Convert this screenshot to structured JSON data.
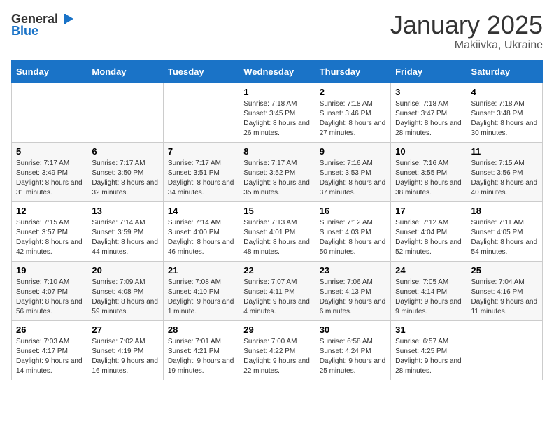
{
  "header": {
    "logo_general": "General",
    "logo_blue": "Blue",
    "month_year": "January 2025",
    "location": "Makiivka, Ukraine"
  },
  "weekdays": [
    "Sunday",
    "Monday",
    "Tuesday",
    "Wednesday",
    "Thursday",
    "Friday",
    "Saturday"
  ],
  "weeks": [
    [
      {
        "day": "",
        "sunrise": "",
        "sunset": "",
        "daylight": ""
      },
      {
        "day": "",
        "sunrise": "",
        "sunset": "",
        "daylight": ""
      },
      {
        "day": "",
        "sunrise": "",
        "sunset": "",
        "daylight": ""
      },
      {
        "day": "1",
        "sunrise": "Sunrise: 7:18 AM",
        "sunset": "Sunset: 3:45 PM",
        "daylight": "Daylight: 8 hours and 26 minutes."
      },
      {
        "day": "2",
        "sunrise": "Sunrise: 7:18 AM",
        "sunset": "Sunset: 3:46 PM",
        "daylight": "Daylight: 8 hours and 27 minutes."
      },
      {
        "day": "3",
        "sunrise": "Sunrise: 7:18 AM",
        "sunset": "Sunset: 3:47 PM",
        "daylight": "Daylight: 8 hours and 28 minutes."
      },
      {
        "day": "4",
        "sunrise": "Sunrise: 7:18 AM",
        "sunset": "Sunset: 3:48 PM",
        "daylight": "Daylight: 8 hours and 30 minutes."
      }
    ],
    [
      {
        "day": "5",
        "sunrise": "Sunrise: 7:17 AM",
        "sunset": "Sunset: 3:49 PM",
        "daylight": "Daylight: 8 hours and 31 minutes."
      },
      {
        "day": "6",
        "sunrise": "Sunrise: 7:17 AM",
        "sunset": "Sunset: 3:50 PM",
        "daylight": "Daylight: 8 hours and 32 minutes."
      },
      {
        "day": "7",
        "sunrise": "Sunrise: 7:17 AM",
        "sunset": "Sunset: 3:51 PM",
        "daylight": "Daylight: 8 hours and 34 minutes."
      },
      {
        "day": "8",
        "sunrise": "Sunrise: 7:17 AM",
        "sunset": "Sunset: 3:52 PM",
        "daylight": "Daylight: 8 hours and 35 minutes."
      },
      {
        "day": "9",
        "sunrise": "Sunrise: 7:16 AM",
        "sunset": "Sunset: 3:53 PM",
        "daylight": "Daylight: 8 hours and 37 minutes."
      },
      {
        "day": "10",
        "sunrise": "Sunrise: 7:16 AM",
        "sunset": "Sunset: 3:55 PM",
        "daylight": "Daylight: 8 hours and 38 minutes."
      },
      {
        "day": "11",
        "sunrise": "Sunrise: 7:15 AM",
        "sunset": "Sunset: 3:56 PM",
        "daylight": "Daylight: 8 hours and 40 minutes."
      }
    ],
    [
      {
        "day": "12",
        "sunrise": "Sunrise: 7:15 AM",
        "sunset": "Sunset: 3:57 PM",
        "daylight": "Daylight: 8 hours and 42 minutes."
      },
      {
        "day": "13",
        "sunrise": "Sunrise: 7:14 AM",
        "sunset": "Sunset: 3:59 PM",
        "daylight": "Daylight: 8 hours and 44 minutes."
      },
      {
        "day": "14",
        "sunrise": "Sunrise: 7:14 AM",
        "sunset": "Sunset: 4:00 PM",
        "daylight": "Daylight: 8 hours and 46 minutes."
      },
      {
        "day": "15",
        "sunrise": "Sunrise: 7:13 AM",
        "sunset": "Sunset: 4:01 PM",
        "daylight": "Daylight: 8 hours and 48 minutes."
      },
      {
        "day": "16",
        "sunrise": "Sunrise: 7:12 AM",
        "sunset": "Sunset: 4:03 PM",
        "daylight": "Daylight: 8 hours and 50 minutes."
      },
      {
        "day": "17",
        "sunrise": "Sunrise: 7:12 AM",
        "sunset": "Sunset: 4:04 PM",
        "daylight": "Daylight: 8 hours and 52 minutes."
      },
      {
        "day": "18",
        "sunrise": "Sunrise: 7:11 AM",
        "sunset": "Sunset: 4:05 PM",
        "daylight": "Daylight: 8 hours and 54 minutes."
      }
    ],
    [
      {
        "day": "19",
        "sunrise": "Sunrise: 7:10 AM",
        "sunset": "Sunset: 4:07 PM",
        "daylight": "Daylight: 8 hours and 56 minutes."
      },
      {
        "day": "20",
        "sunrise": "Sunrise: 7:09 AM",
        "sunset": "Sunset: 4:08 PM",
        "daylight": "Daylight: 8 hours and 59 minutes."
      },
      {
        "day": "21",
        "sunrise": "Sunrise: 7:08 AM",
        "sunset": "Sunset: 4:10 PM",
        "daylight": "Daylight: 9 hours and 1 minute."
      },
      {
        "day": "22",
        "sunrise": "Sunrise: 7:07 AM",
        "sunset": "Sunset: 4:11 PM",
        "daylight": "Daylight: 9 hours and 4 minutes."
      },
      {
        "day": "23",
        "sunrise": "Sunrise: 7:06 AM",
        "sunset": "Sunset: 4:13 PM",
        "daylight": "Daylight: 9 hours and 6 minutes."
      },
      {
        "day": "24",
        "sunrise": "Sunrise: 7:05 AM",
        "sunset": "Sunset: 4:14 PM",
        "daylight": "Daylight: 9 hours and 9 minutes."
      },
      {
        "day": "25",
        "sunrise": "Sunrise: 7:04 AM",
        "sunset": "Sunset: 4:16 PM",
        "daylight": "Daylight: 9 hours and 11 minutes."
      }
    ],
    [
      {
        "day": "26",
        "sunrise": "Sunrise: 7:03 AM",
        "sunset": "Sunset: 4:17 PM",
        "daylight": "Daylight: 9 hours and 14 minutes."
      },
      {
        "day": "27",
        "sunrise": "Sunrise: 7:02 AM",
        "sunset": "Sunset: 4:19 PM",
        "daylight": "Daylight: 9 hours and 16 minutes."
      },
      {
        "day": "28",
        "sunrise": "Sunrise: 7:01 AM",
        "sunset": "Sunset: 4:21 PM",
        "daylight": "Daylight: 9 hours and 19 minutes."
      },
      {
        "day": "29",
        "sunrise": "Sunrise: 7:00 AM",
        "sunset": "Sunset: 4:22 PM",
        "daylight": "Daylight: 9 hours and 22 minutes."
      },
      {
        "day": "30",
        "sunrise": "Sunrise: 6:58 AM",
        "sunset": "Sunset: 4:24 PM",
        "daylight": "Daylight: 9 hours and 25 minutes."
      },
      {
        "day": "31",
        "sunrise": "Sunrise: 6:57 AM",
        "sunset": "Sunset: 4:25 PM",
        "daylight": "Daylight: 9 hours and 28 minutes."
      },
      {
        "day": "",
        "sunrise": "",
        "sunset": "",
        "daylight": ""
      }
    ]
  ]
}
